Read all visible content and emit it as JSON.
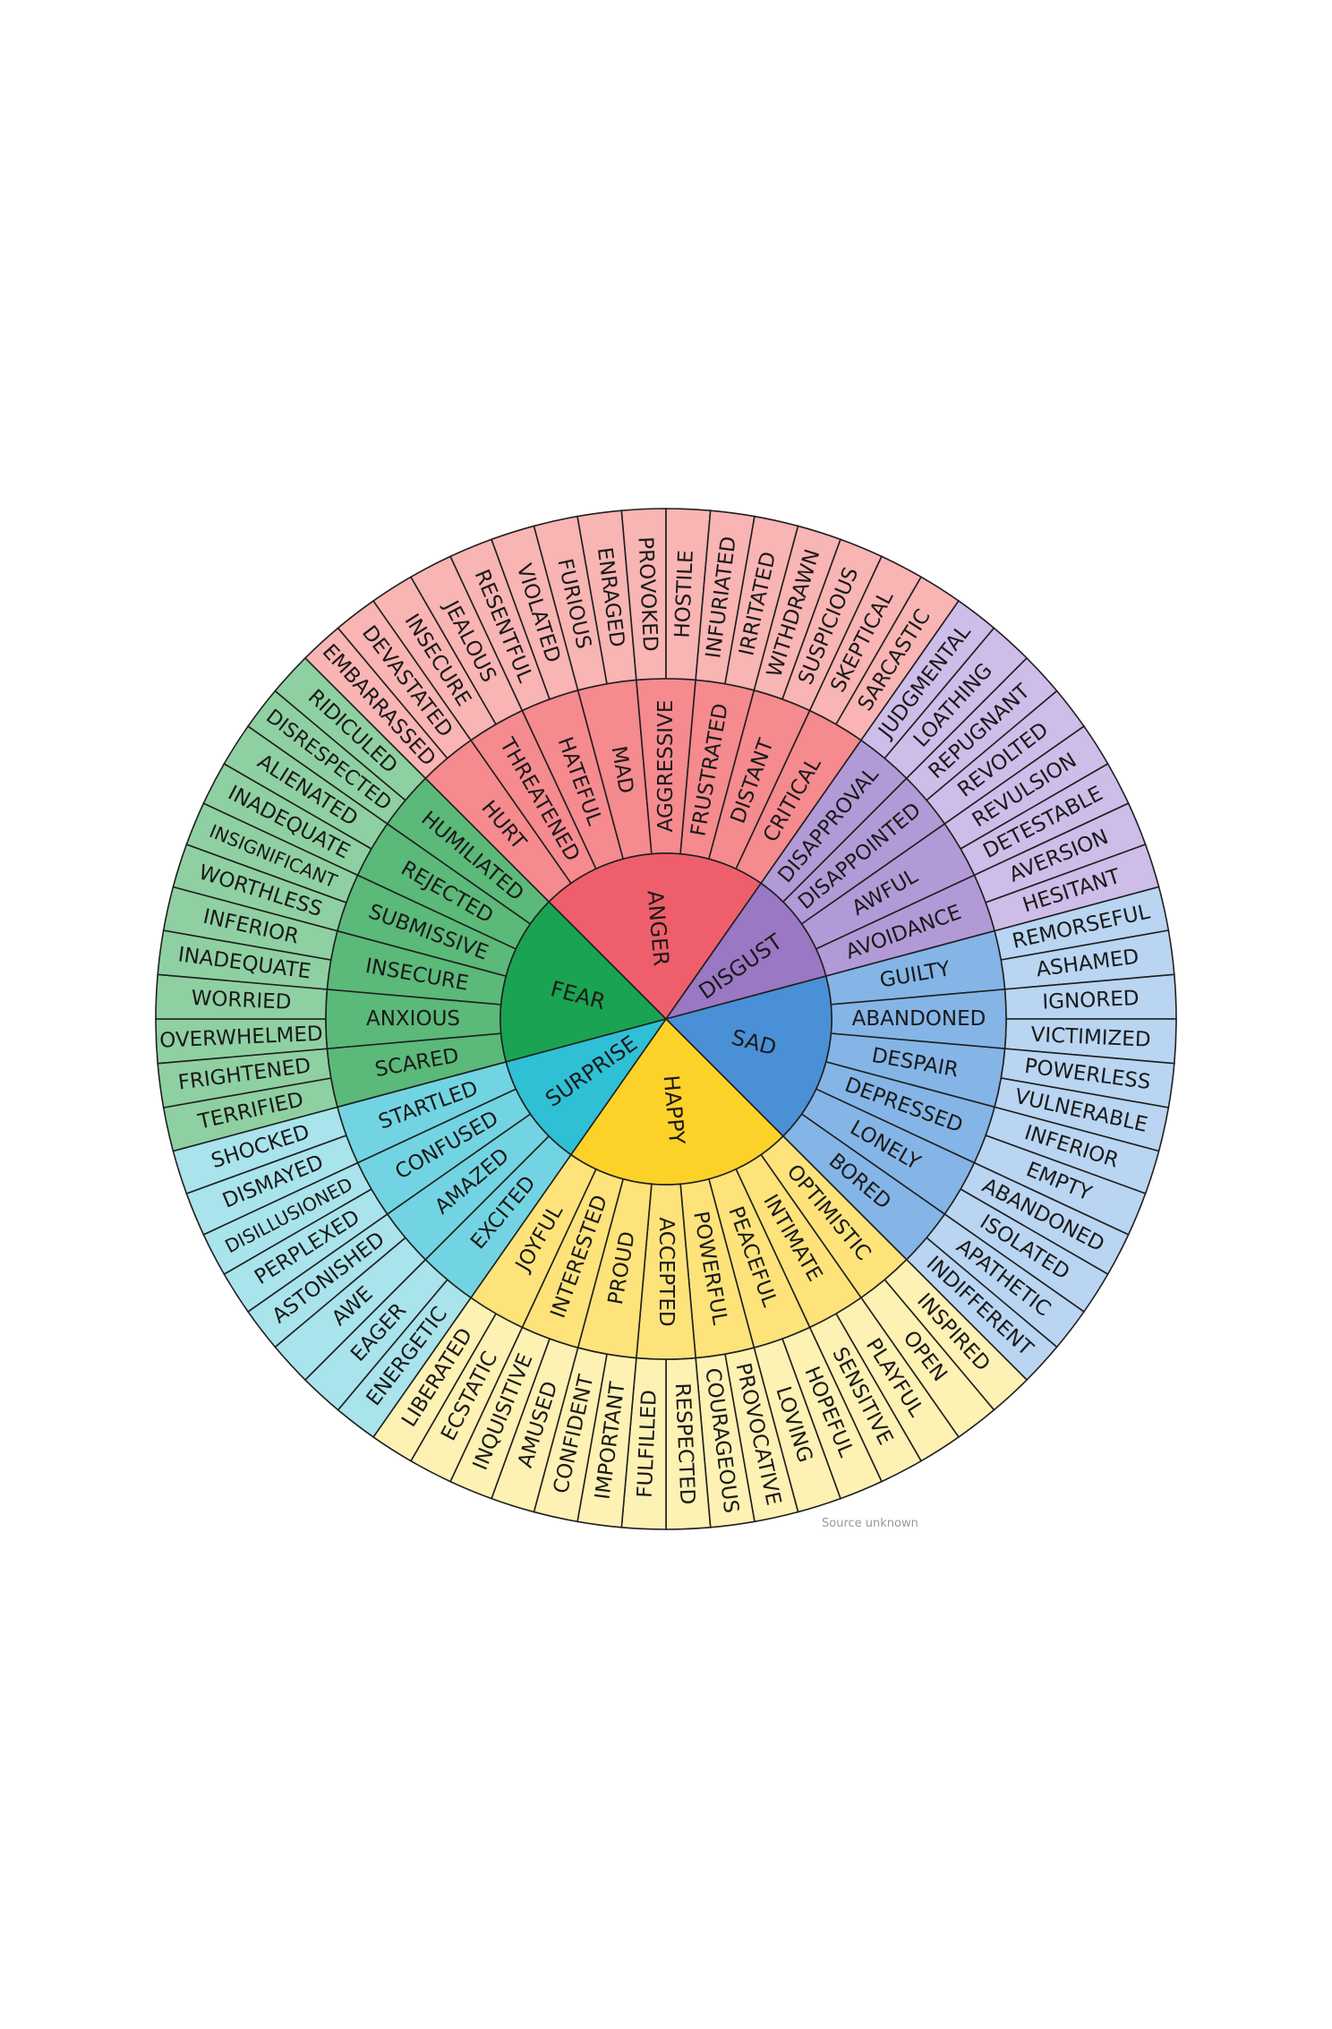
{
  "source_note": "Source unknown",
  "colors": {
    "outline": "#1f1f1f",
    "background": "#ffffff"
  },
  "wheel": [
    {
      "core": "ANGER",
      "color_core": "#ee5f6b",
      "color_mid": "#f58a8f",
      "color_outer": "#f9b4b4",
      "groups": [
        {
          "mid": "HURT",
          "outer": [
            "EMBARRASSED",
            "DEVASTATED"
          ]
        },
        {
          "mid": "THREATENED",
          "outer": [
            "INSECURE",
            "JEALOUS"
          ]
        },
        {
          "mid": "HATEFUL",
          "outer": [
            "RESENTFUL",
            "VIOLATED"
          ]
        },
        {
          "mid": "MAD",
          "outer": [
            "FURIOUS",
            "ENRAGED"
          ]
        },
        {
          "mid": "AGGRESSIVE",
          "outer": [
            "PROVOKED",
            "HOSTILE"
          ]
        },
        {
          "mid": "FRUSTRATED",
          "outer": [
            "INFURIATED",
            "IRRITATED"
          ]
        },
        {
          "mid": "DISTANT",
          "outer": [
            "WITHDRAWN",
            "SUSPICIOUS"
          ]
        },
        {
          "mid": "CRITICAL",
          "outer": [
            "SKEPTICAL",
            "SARCASTIC"
          ]
        }
      ]
    },
    {
      "core": "DISGUST",
      "color_core": "#9a78c4",
      "color_mid": "#b29ad6",
      "color_outer": "#cdbde8",
      "groups": [
        {
          "mid": "DISAPPROVAL",
          "outer": [
            "JUDGMENTAL",
            "LOATHING"
          ]
        },
        {
          "mid": "DISAPPOINTED",
          "outer": [
            "REPUGNANT",
            "REVOLTED"
          ]
        },
        {
          "mid": "AWFUL",
          "outer": [
            "REVULSION",
            "DETESTABLE"
          ]
        },
        {
          "mid": "AVOIDANCE",
          "outer": [
            "AVERSION",
            "HESITANT"
          ]
        }
      ]
    },
    {
      "core": "SAD",
      "color_core": "#4a90d6",
      "color_mid": "#84b5e6",
      "color_outer": "#b9d5f1",
      "groups": [
        {
          "mid": "GUILTY",
          "outer": [
            "REMORSEFUL",
            "ASHAMED"
          ]
        },
        {
          "mid": "ABANDONED",
          "outer": [
            "IGNORED",
            "VICTIMIZED"
          ]
        },
        {
          "mid": "DESPAIR",
          "outer": [
            "POWERLESS",
            "VULNERABLE"
          ]
        },
        {
          "mid": "DEPRESSED",
          "outer": [
            "INFERIOR",
            "EMPTY"
          ]
        },
        {
          "mid": "LONELY",
          "outer": [
            "ABANDONED",
            "ISOLATED"
          ]
        },
        {
          "mid": "BORED",
          "outer": [
            "APATHETIC",
            "INDIFFERENT"
          ]
        }
      ]
    },
    {
      "core": "HAPPY",
      "color_core": "#fdd228",
      "color_mid": "#fde37a",
      "color_outer": "#fef1b4",
      "groups": [
        {
          "mid": "OPTIMISTIC",
          "outer": [
            "INSPIRED",
            "OPEN"
          ]
        },
        {
          "mid": "INTIMATE",
          "outer": [
            "PLAYFUL",
            "SENSITIVE"
          ]
        },
        {
          "mid": "PEACEFUL",
          "outer": [
            "HOPEFUL",
            "LOVING"
          ]
        },
        {
          "mid": "POWERFUL",
          "outer": [
            "PROVOCATIVE",
            "COURAGEOUS"
          ]
        },
        {
          "mid": "ACCEPTED",
          "outer": [
            "RESPECTED",
            "FULFILLED"
          ]
        },
        {
          "mid": "PROUD",
          "outer": [
            "IMPORTANT",
            "CONFIDENT"
          ]
        },
        {
          "mid": "INTERESTED",
          "outer": [
            "AMUSED",
            "INQUISITIVE"
          ]
        },
        {
          "mid": "JOYFUL",
          "outer": [
            "ECSTATIC",
            "LIBERATED"
          ]
        }
      ]
    },
    {
      "core": "SURPRISE",
      "color_core": "#2fc0d6",
      "color_mid": "#72d4e2",
      "color_outer": "#a9e3ec",
      "groups": [
        {
          "mid": "EXCITED",
          "outer": [
            "ENERGETIC",
            "EAGER"
          ]
        },
        {
          "mid": "AMAZED",
          "outer": [
            "AWE",
            "ASTONISHED"
          ]
        },
        {
          "mid": "CONFUSED",
          "outer": [
            "PERPLEXED",
            "DISILLUSIONED"
          ]
        },
        {
          "mid": "STARTLED",
          "outer": [
            "DISMAYED",
            "SHOCKED"
          ]
        }
      ]
    },
    {
      "core": "FEAR",
      "color_core": "#1aa352",
      "color_mid": "#5bb97a",
      "color_outer": "#8fd0a2",
      "groups": [
        {
          "mid": "SCARED",
          "outer": [
            "TERRIFIED",
            "FRIGHTENED"
          ]
        },
        {
          "mid": "ANXIOUS",
          "outer": [
            "OVERWHELMED",
            "WORRIED"
          ]
        },
        {
          "mid": "INSECURE",
          "outer": [
            "INADEQUATE",
            "INFERIOR"
          ]
        },
        {
          "mid": "SUBMISSIVE",
          "outer": [
            "WORTHLESS",
            "INSIGNIFICANT"
          ]
        },
        {
          "mid": "REJECTED",
          "outer": [
            "INADEQUATE",
            "ALIENATED"
          ]
        },
        {
          "mid": "HUMILIATED",
          "outer": [
            "DISRESPECTED",
            "RIDICULED"
          ]
        }
      ]
    }
  ]
}
